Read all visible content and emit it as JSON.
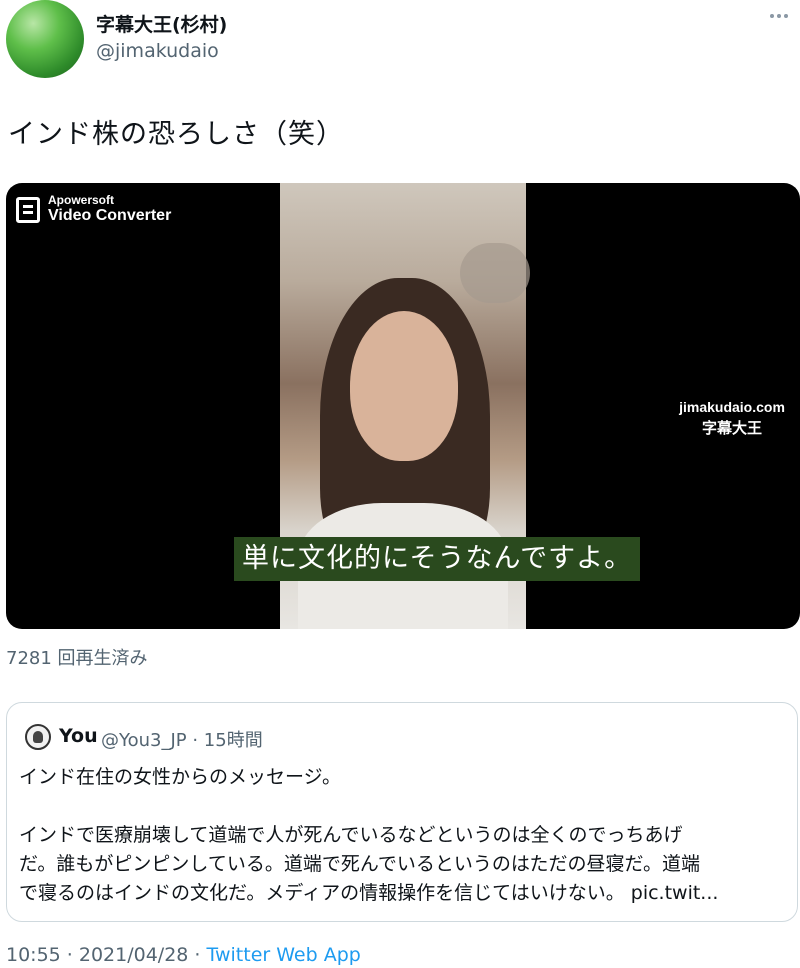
{
  "author": {
    "display_name": "字幕大王(杉村)",
    "handle": "@jimakudaio",
    "avatar_icon": "leaf-avatar"
  },
  "tweet": {
    "text": "インド株の恐ろしさ（笑）"
  },
  "video": {
    "logo_line1": "Apowersoft",
    "logo_line2": "Video Converter",
    "watermark_line1": "jimakudaio.com",
    "watermark_line2": "字幕大王",
    "subtitle": "単に文化的にそうなんですよ。",
    "view_count": "7281 回再生済み"
  },
  "quoted_tweet": {
    "name": "You",
    "handle_time": "@You3_JP · 15時間",
    "lines": [
      "インド在住の女性からのメッセージ。",
      "",
      "インドで医療崩壊して道端で人が死んでいるなどというのは全くのでっちあげ",
      "だ。誰もがピンピンしている。道端で死んでいるというのはただの昼寝だ。道端",
      "で寝るのはインドの文化だ。メディアの情報操作を信じてはいけない。 pic.twit..."
    ]
  },
  "footer": {
    "time_date": "10:55 · 2021/04/28 · ",
    "source": "Twitter Web App"
  },
  "colors": {
    "text": "#0f1419",
    "secondary": "#536471",
    "link": "#1d9bf0",
    "border": "#cfd9de"
  }
}
